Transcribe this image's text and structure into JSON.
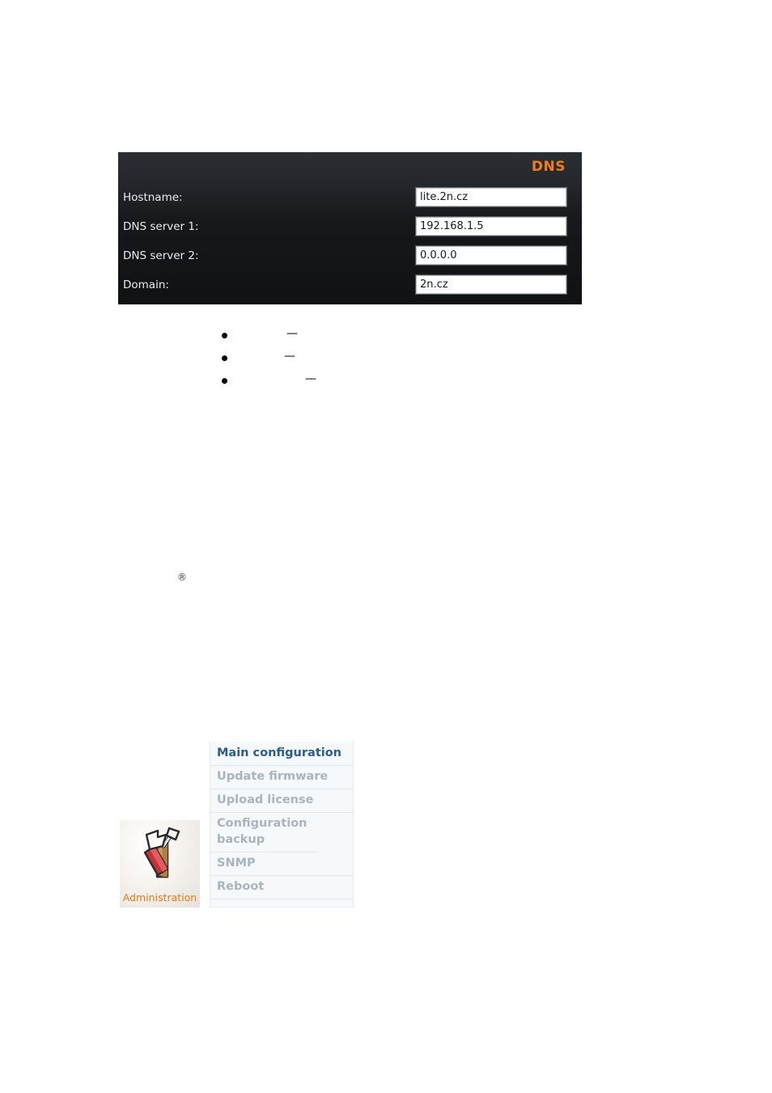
{
  "dns_panel": {
    "title": "DNS",
    "title_color": "#f07d1a",
    "background_color": "#17191c",
    "rows": [
      {
        "label": "Hostname:",
        "value": "lite.2n.cz"
      },
      {
        "label": "DNS server 1:",
        "value": "192.168.1.5"
      },
      {
        "label": "DNS server 2:",
        "value": "0.0.0.0"
      },
      {
        "label": "Domain:",
        "value": "2n.cz"
      }
    ]
  },
  "bullet_list": {
    "items": [
      {
        "marker": "•",
        "text": "—",
        "indent": 96
      },
      {
        "marker": "•",
        "text": "—",
        "indent": 93
      },
      {
        "marker": "•",
        "text": "—",
        "indent": 119
      }
    ]
  },
  "registered_mark": {
    "symbol": "®"
  },
  "administration": {
    "icon_label": "Administration",
    "icon_label_color": "#e07b18",
    "icon_name": "screwdriver-and-chisel-icon",
    "menu_items": [
      {
        "label": "Main configuration",
        "state": "active"
      },
      {
        "label": "Update firmware",
        "state": "inactive"
      },
      {
        "label": "Upload license",
        "state": "inactive"
      },
      {
        "label": "Configuration backup",
        "state": "inactive"
      },
      {
        "label": "SNMP",
        "state": "inactive"
      },
      {
        "label": "Reboot",
        "state": "inactive"
      }
    ],
    "active_color": "#2c5d8f",
    "inactive_color": "#a9b4bd"
  }
}
